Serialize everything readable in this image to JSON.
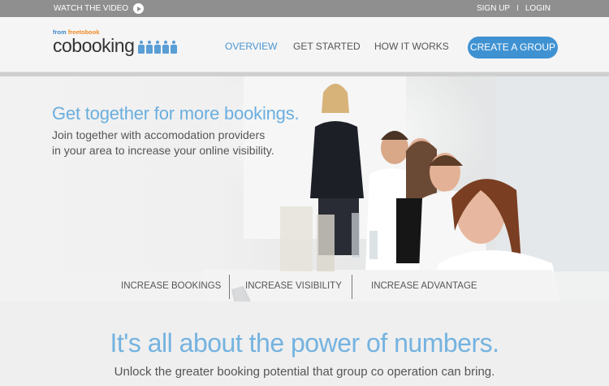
{
  "topbar": {
    "watch_label": "WATCH THE VIDEO",
    "signup": "SIGN UP",
    "separator": "I",
    "login": "LOGIN"
  },
  "logo": {
    "from_prefix": "from ",
    "from_brand": "freetobook",
    "wordmark_co": "co",
    "wordmark_rest": "booking"
  },
  "nav": {
    "overview": "OVERVIEW",
    "get_started": "GET STARTED",
    "how_it_works": "HOW IT WORKS",
    "cta": "CREATE A GROUP"
  },
  "hero": {
    "title": "Get together for more bookings.",
    "subtitle_line1": "Join together with accomodation providers",
    "subtitle_line2": "in your area to increase your online visibility."
  },
  "benefits": {
    "bookings": "INCREASE BOOKINGS",
    "visibility": "INCREASE VISIBILITY",
    "advantage": "INCREASE ADVANTAGE"
  },
  "tagline": {
    "title": "It's all about the power of numbers.",
    "subtitle": "Unlock the greater booking potential that group co operation can bring."
  },
  "colors": {
    "accent": "#3f92d2",
    "topbar": "#8f8f8f",
    "hero_title": "#6aaedf"
  }
}
